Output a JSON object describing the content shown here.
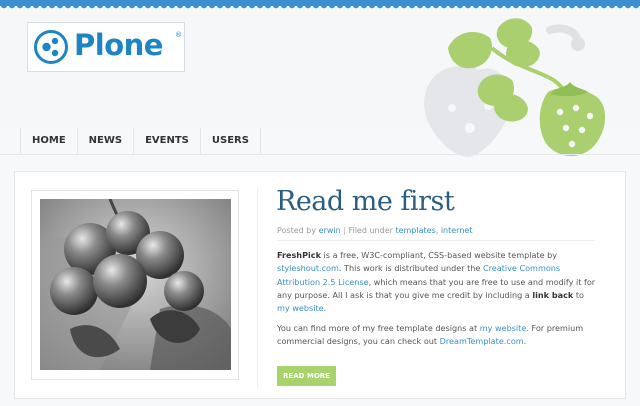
{
  "logo": {
    "text": "Plone",
    "mark": "®"
  },
  "nav": {
    "items": [
      "HOME",
      "NEWS",
      "EVENTS",
      "USERS"
    ]
  },
  "article": {
    "title": "Read me first",
    "meta": {
      "posted_prefix": "Posted by ",
      "author": "erwin",
      "sep": " | ",
      "filed_prefix": "Filed under ",
      "tags": [
        "templates",
        "internet"
      ]
    },
    "para1": {
      "a": "FreshPick",
      "b": " is a free, W3C-compliant, CSS-based website template by ",
      "c": "styleshout.com",
      "d": ". This work is distributed under the ",
      "e": "Creative Commons Attribution 2.5 License",
      "f": ", which means that you are free to use and modify it for any purpose. All I ask is that you give me credit by including a ",
      "g": "link back",
      "h": " to ",
      "i": "my website",
      "j": "."
    },
    "para2": {
      "a": "You can find more of my free template designs at ",
      "b": "my website",
      "c": ". For premium commercial designs, you can check out ",
      "d": "DreamTemplate.com",
      "e": "."
    },
    "read_more": "READ MORE"
  },
  "colors": {
    "brand": "#1d85c4",
    "title": "#2b5d83",
    "link": "#3a8fc4",
    "button": "#a7d26c",
    "art_green": "#a9cf6e"
  },
  "icons": [
    "plone-logo-icon",
    "strawberry-art",
    "berries-photo"
  ]
}
